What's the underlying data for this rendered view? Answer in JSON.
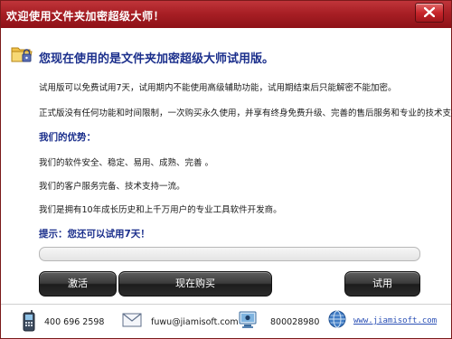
{
  "window": {
    "title": "欢迎使用文件夹加密超级大师！"
  },
  "main": {
    "heading": "您现在使用的是文件夹加密超级大师试用版。",
    "trial_note": "试用版可以免费试用7天，试用期内不能使用高级辅助功能，试用期结束后只能解密不能加密。",
    "full_note": "正式版没有任何功能和时间限制，一次购买永久使用，并享有终身免费升级、完善的售后服务和专业的技术支持。",
    "advantages_title": "我们的优势：",
    "advantages": [
      "我们的软件安全、稳定、易用、成熟、完善 。",
      "我们的客户服务完备、技术支持一流。",
      "我们是拥有10年成长历史和上千万用户的专业工具软件开发商。"
    ],
    "tip": "提示：您还可以试用7天！",
    "trial_progress": 0
  },
  "buttons": {
    "activate": "激活",
    "buy_now": "现在购买",
    "trial": "试用"
  },
  "contact": {
    "phone": "400 696 2598",
    "email": "fuwu@jiamisoft.com",
    "qq": "800028980",
    "website": "www.jiamisoft.com"
  },
  "icons": {
    "app": "folder-lock-icon",
    "phone": "phone-icon",
    "email": "envelope-icon",
    "qq": "qq-icon",
    "web": "globe-icon"
  },
  "colors": {
    "titlebar": "#a81f25",
    "heading": "#1b2f8c",
    "link": "#2a4fb5"
  }
}
